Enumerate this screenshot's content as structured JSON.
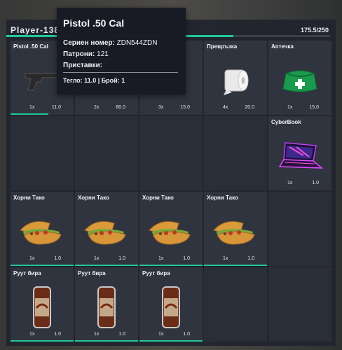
{
  "header": {
    "player_name": "Player-138",
    "weight": "175.5/250",
    "weight_fraction": 0.702
  },
  "tooltip": {
    "title": "Pistol .50 Cal",
    "serial_label": "Сериен номер:",
    "serial_value": "ZDN544ZDN",
    "ammo_label": "Патрони:",
    "ammo_value": "121",
    "attachments_label": "Приставки:",
    "footer": "Тегло: 11.0 | Брой: 1"
  },
  "slots": [
    {
      "name": "Pistol .50 Cal",
      "count": "1x",
      "weight": "11.0",
      "icon": "pistol-icon"
    },
    {
      "name": "",
      "count": "2x",
      "weight": "80.0",
      "icon": "item-icon"
    },
    {
      "name": "",
      "count": "3x",
      "weight": "15.0",
      "icon": "item-icon"
    },
    {
      "name": "Превръзка",
      "count": "4x",
      "weight": "20.0",
      "icon": "bandage-roll-icon"
    },
    {
      "name": "Аптечка",
      "count": "1x",
      "weight": "15.0",
      "icon": "first-aid-kit-icon"
    },
    {
      "name": "CyberBook",
      "count": "1x",
      "weight": "1.0",
      "icon": "laptop-icon"
    },
    {
      "name": "Хорни Тако",
      "count": "1x",
      "weight": "1.0",
      "icon": "taco-icon"
    },
    {
      "name": "Хорни Тако",
      "count": "1x",
      "weight": "1.0",
      "icon": "taco-icon"
    },
    {
      "name": "Хорни Тако",
      "count": "1x",
      "weight": "1.0",
      "icon": "taco-icon"
    },
    {
      "name": "Хорни Тако",
      "count": "1x",
      "weight": "1.0",
      "icon": "taco-icon"
    },
    {
      "name": "Руут бира",
      "count": "1x",
      "weight": "1.0",
      "icon": "root-beer-can-icon"
    },
    {
      "name": "Руут бира",
      "count": "1x",
      "weight": "1.0",
      "icon": "root-beer-can-icon"
    },
    {
      "name": "Руут бира",
      "count": "1x",
      "weight": "1.0",
      "icon": "root-beer-can-icon"
    }
  ],
  "colors": {
    "accent": "#21c79a",
    "panel": "#21242e",
    "slot": "#30343f"
  }
}
